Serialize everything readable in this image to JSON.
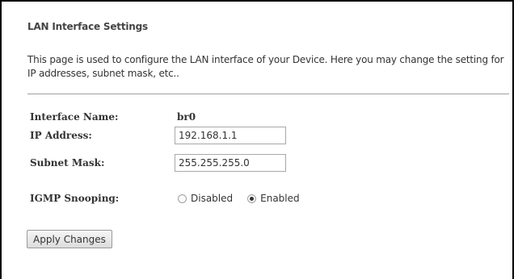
{
  "page": {
    "title": "LAN Interface Settings",
    "description": "This page is used to configure the LAN interface of your Device. Here you may change the setting for IP addresses, subnet mask, etc.."
  },
  "form": {
    "interface_name": {
      "label": "Interface Name:",
      "value": "br0"
    },
    "ip_address": {
      "label": "IP Address:",
      "value": "192.168.1.1"
    },
    "subnet_mask": {
      "label": "Subnet Mask:",
      "value": "255.255.255.0"
    },
    "igmp_snooping": {
      "label": "IGMP Snooping:",
      "options": [
        {
          "label": "Disabled",
          "checked": false
        },
        {
          "label": "Enabled",
          "checked": true
        }
      ]
    }
  },
  "actions": {
    "apply_label": "Apply Changes"
  }
}
